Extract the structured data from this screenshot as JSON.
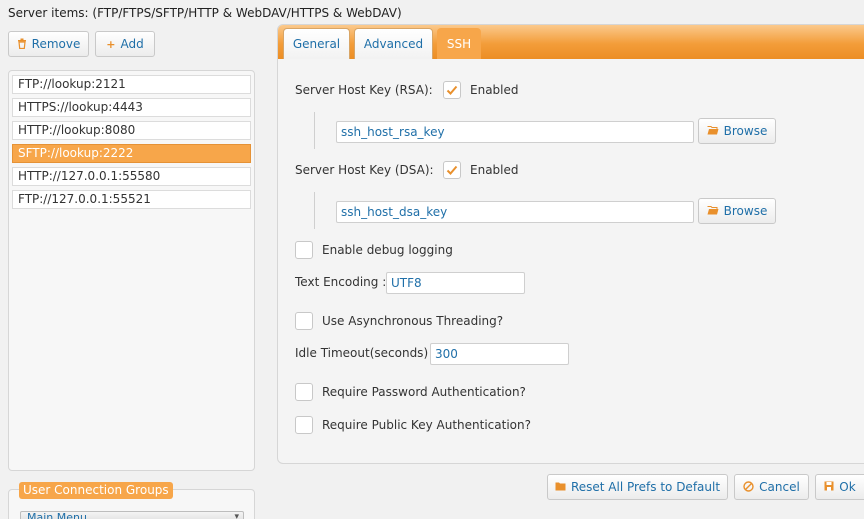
{
  "header": {
    "title": "Server items: (FTP/FTPS/SFTP/HTTP & WebDAV/HTTPS & WebDAV)"
  },
  "toolbar": {
    "remove_label": "Remove",
    "add_label": "Add"
  },
  "servers": [
    {
      "label": "FTP://lookup:2121",
      "selected": false
    },
    {
      "label": "HTTPS://lookup:4443",
      "selected": false
    },
    {
      "label": "HTTP://lookup:8080",
      "selected": false
    },
    {
      "label": "SFTP://lookup:2222",
      "selected": true
    },
    {
      "label": "HTTP://127.0.0.1:55580",
      "selected": false
    },
    {
      "label": "FTP://127.0.0.1:55521",
      "selected": false
    }
  ],
  "groups": {
    "legend": "User Connection Groups",
    "selected": "Main Menu"
  },
  "tabs": [
    {
      "label": "General",
      "active": false
    },
    {
      "label": "Advanced",
      "active": false
    },
    {
      "label": "SSH",
      "active": true
    }
  ],
  "ssh": {
    "rsa_label": "Server Host Key (RSA):",
    "rsa_enabled_label": "Enabled",
    "rsa_enabled": true,
    "rsa_key_value": "ssh_host_rsa_key",
    "dsa_label": "Server Host Key (DSA):",
    "dsa_enabled_label": "Enabled",
    "dsa_enabled": true,
    "dsa_key_value": "ssh_host_dsa_key",
    "browse_label": "Browse",
    "debug_label": "Enable debug logging",
    "debug_checked": false,
    "encoding_label": "Text Encoding :",
    "encoding_value": "UTF8",
    "async_label": "Use Asynchronous Threading?",
    "async_checked": false,
    "timeout_label": "Idle Timeout(seconds) :",
    "timeout_value": "300",
    "req_password_label": "Require Password Authentication?",
    "req_password_checked": false,
    "req_pubkey_label": "Require Public Key Authentication?",
    "req_pubkey_checked": false
  },
  "footer": {
    "reset_label": "Reset All Prefs to Default",
    "cancel_label": "Cancel",
    "ok_label": "Ok"
  },
  "colors": {
    "accent": "#f7a64a",
    "link": "#1f6fa8",
    "check": "#e9902c"
  }
}
